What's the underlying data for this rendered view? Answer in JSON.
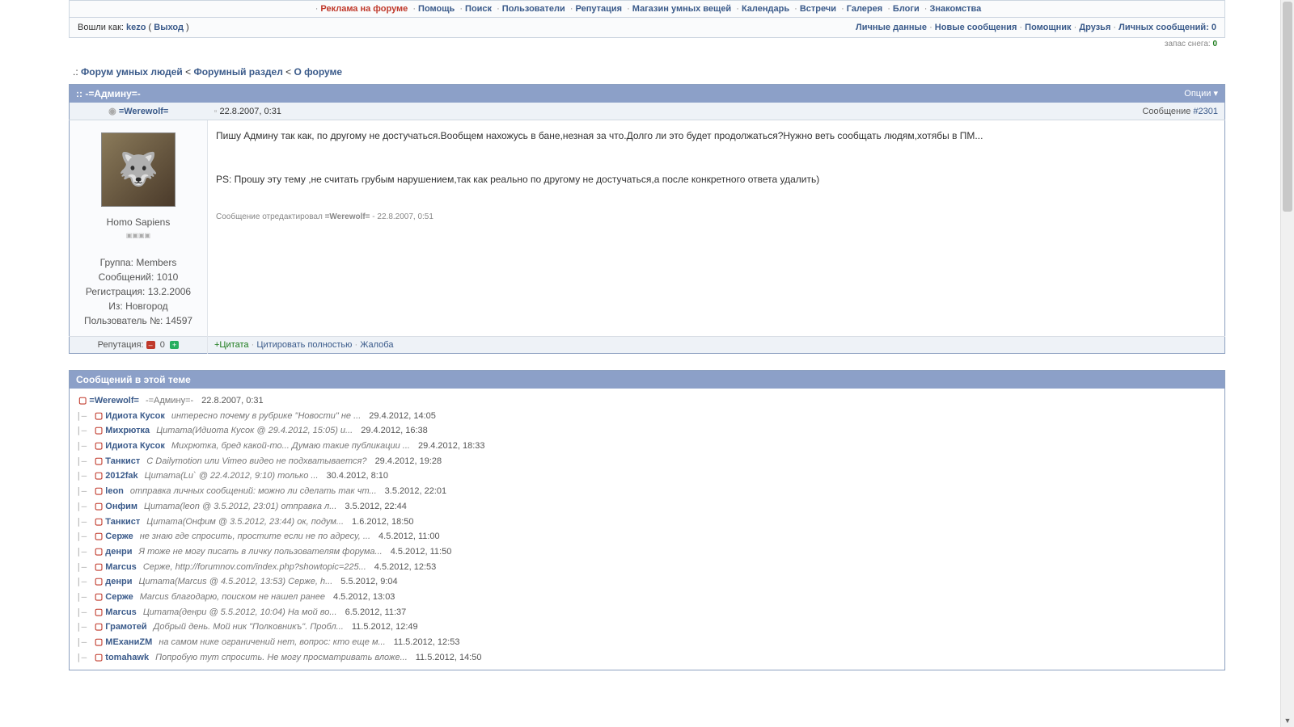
{
  "nav": {
    "items": [
      {
        "label": "Реклама на форуме",
        "featured": true
      },
      {
        "label": "Помощь"
      },
      {
        "label": "Поиск"
      },
      {
        "label": "Пользователи"
      },
      {
        "label": "Репутация"
      },
      {
        "label": "Магазин умных вещей"
      },
      {
        "label": "Календарь"
      },
      {
        "label": "Встречи"
      },
      {
        "label": "Галерея"
      },
      {
        "label": "Блоги"
      },
      {
        "label": "Знакомства"
      }
    ]
  },
  "userbar": {
    "logged_prefix": "Вошли как: ",
    "username": "kezo",
    "logout": "Выход",
    "links": [
      {
        "label": "Личные данные"
      },
      {
        "label": "Новые сообщения"
      },
      {
        "label": "Помощник"
      },
      {
        "label": "Друзья"
      }
    ],
    "pm_label": "Личных сообщений: ",
    "pm_count": "0",
    "snow_label": "запас снега: ",
    "snow_count": "0"
  },
  "breadcrumb": {
    "prefix": ".: ",
    "parts": [
      "Форум умных людей",
      "Форумный раздел",
      "О форуме"
    ],
    "sep": " < "
  },
  "topic": {
    "marker": ":: ",
    "title": "-=Админу=-",
    "options": "Опции"
  },
  "post": {
    "author": "=Werewolf=",
    "date": "22.8.2007, 0:31",
    "msg_prefix": "Сообщение ",
    "msg_num": "#2301",
    "rank": "Homo Sapiens",
    "info_group": "Группа: Members",
    "info_posts": "Сообщений: 1010",
    "info_reg": "Регистрация: 13.2.2006",
    "info_from": "Из: Новгород",
    "info_uid": "Пользователь №: 14597",
    "body_p1": "Пишу Админу так как, по другому не достучаться.Вообщем нахожусь в бане,незная за что.Долго ли это будет продолжаться?Нужно веть сообщать людям,хотябы в ПМ...",
    "body_p2": "PS: Прошу эту тему ,не считать грубым нарушением,так как реально по другому не достучаться,а после конкретного ответа удалить)",
    "edit_prefix": "Сообщение отредактировал ",
    "edit_by": "=Werewolf=",
    "edit_suffix": " - 22.8.2007, 0:51",
    "rep_label": "Репутация: ",
    "rep_value": "0",
    "act_quote": "+Цитата",
    "act_quote_full": "Цитировать полностью",
    "act_report": "Жалоба"
  },
  "replies": {
    "header": "Сообщений в этой теме",
    "items": [
      {
        "indent": 0,
        "user": "=Werewolf=",
        "excerpt": "-=Админу=-",
        "date": "22.8.2007, 0:31",
        "current": true
      },
      {
        "indent": 1,
        "user": "Идиота Кусок",
        "excerpt": "интересно почему в рубрике \"Новости\" не ...",
        "date": "29.4.2012, 14:05"
      },
      {
        "indent": 2,
        "user": "Михрютка",
        "excerpt": "Цитата(Идиота Кусок @ 29.4.2012, 15:05) и...",
        "date": "29.4.2012, 16:38"
      },
      {
        "indent": 1,
        "user": "Идиота Кусок",
        "excerpt": "Михрютка, бред какой-то... Думаю такие публикации ...",
        "date": "29.4.2012, 18:33"
      },
      {
        "indent": 1,
        "user": "Танкист",
        "excerpt": "С Dailymotion или Vimeo видео не подхватывается?",
        "date": "29.4.2012, 19:28"
      },
      {
        "indent": 1,
        "user": "2012fak",
        "excerpt": "Цитата(Lu` @ 22.4.2012, 9:10) только ...",
        "date": "30.4.2012, 8:10"
      },
      {
        "indent": 1,
        "user": "leon",
        "excerpt": "отправка личных сообщений: можно ли сделать так чт...",
        "date": "3.5.2012, 22:01"
      },
      {
        "indent": 2,
        "user": "Онфим",
        "excerpt": "Цитата(leon @ 3.5.2012, 23:01) отправка л...",
        "date": "3.5.2012, 22:44"
      },
      {
        "indent": 3,
        "user": "Танкист",
        "excerpt": "Цитата(Онфим @ 3.5.2012, 23:44) ок, подум...",
        "date": "1.6.2012, 18:50"
      },
      {
        "indent": 1,
        "user": "Серже",
        "excerpt": "не знаю где спросить, простите если не по адресу, ...",
        "date": "4.5.2012, 11:00"
      },
      {
        "indent": 1,
        "user": "денри",
        "excerpt": "Я тоже не могу писать в личку пользователям форума...",
        "date": "4.5.2012, 11:50"
      },
      {
        "indent": 1,
        "user": "Marcus",
        "excerpt": "Серже, http://forumnov.com/index.php?showtopic=225...",
        "date": "4.5.2012, 12:53"
      },
      {
        "indent": 2,
        "user": "денри",
        "excerpt": "Цитата(Marcus @ 4.5.2012, 13:53) Серже, h...",
        "date": "5.5.2012, 9:04"
      },
      {
        "indent": 1,
        "user": "Серже",
        "excerpt": "Marcus благодарю, поиском не нашел ранее",
        "date": "4.5.2012, 13:03"
      },
      {
        "indent": 1,
        "user": "Marcus",
        "excerpt": "Цитата(денри @ 5.5.2012, 10:04) На мой во...",
        "date": "6.5.2012, 11:37"
      },
      {
        "indent": 1,
        "user": "Грамотей",
        "excerpt": "Добрый день. Мой ник \"Полковникъ\". Пробл...",
        "date": "11.5.2012, 12:49"
      },
      {
        "indent": 1,
        "user": "МЕханиZM",
        "excerpt": "на самом нике ограничений нет, вопрос: кто еще м...",
        "date": "11.5.2012, 12:53"
      },
      {
        "indent": 1,
        "user": "tomahawk",
        "excerpt": "Попробую тут спросить. Не могу просматривать вложе...",
        "date": "11.5.2012, 14:50"
      }
    ]
  }
}
